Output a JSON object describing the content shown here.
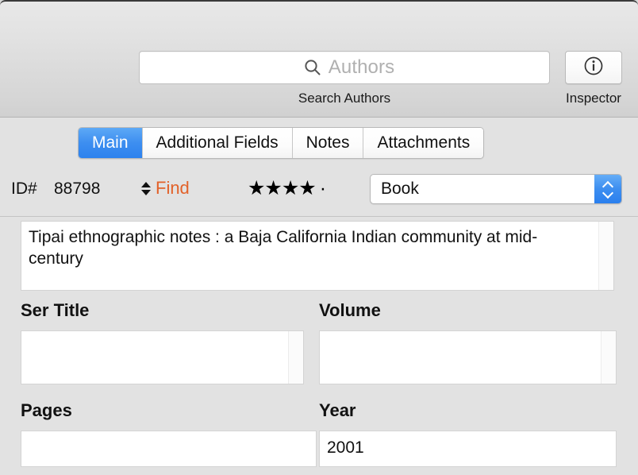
{
  "toolbar": {
    "search": {
      "icon": "search-icon",
      "value": "",
      "placeholder": "Authors",
      "caption": "Search Authors"
    },
    "inspector": {
      "icon": "info-circle-icon",
      "caption": "Inspector"
    }
  },
  "tabs": [
    {
      "label": "Main",
      "selected": true
    },
    {
      "label": "Additional Fields",
      "selected": false
    },
    {
      "label": "Notes",
      "selected": false
    },
    {
      "label": "Attachments",
      "selected": false
    }
  ],
  "record": {
    "id_label": "ID#",
    "id_value": "88798",
    "stepper_icon": "up-down-stepper-icon",
    "find_label": "Find",
    "rating": {
      "filled": 4,
      "total": 5,
      "filled_glyph": "★",
      "empty_glyph": "·"
    },
    "type_popup": {
      "value": "Book",
      "arrows_icon": "chevron-up-down-icon",
      "accent_color": "#3d8ef0"
    },
    "title": {
      "value": "Tipai ethnographic notes : a Baja California Indian community at mid-century"
    },
    "fields": [
      {
        "label": "Ser Title",
        "value": ""
      },
      {
        "label": "Volume",
        "value": ""
      },
      {
        "label": "Pages",
        "value": ""
      },
      {
        "label": "Year",
        "value": "2001"
      }
    ]
  },
  "colors": {
    "selected_tab": "#3d8ef0",
    "find_text": "#e2622a",
    "window_chrome": "#e2e2e2"
  }
}
